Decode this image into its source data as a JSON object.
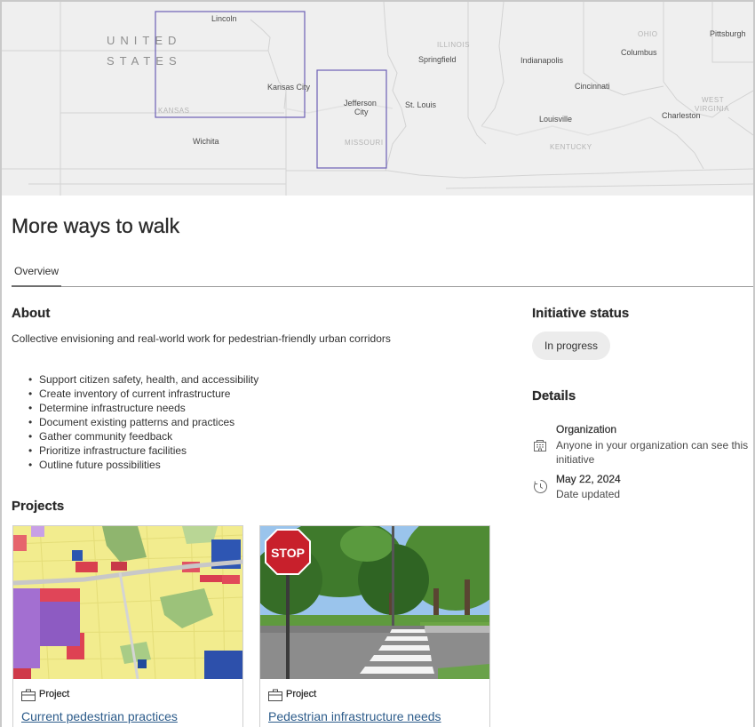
{
  "map": {
    "country_line1": "UNITED",
    "country_line2": "STATES",
    "labels": {
      "lincoln": "Lincoln",
      "kansas_city": "Kansas City",
      "kansas": "KANSAS",
      "wichita": "Wichita",
      "jefferson_city_1": "Jefferson",
      "jefferson_city_2": "City",
      "missouri": "MISSOURI",
      "st_louis": "St. Louis",
      "illinois": "ILLINOIS",
      "springfield": "Springfield",
      "indianapolis": "Indianapolis",
      "ohio": "OHIO",
      "columbus": "Columbus",
      "pittsburgh": "Pittsburgh",
      "cincinnati": "Cincinnati",
      "louisville": "Louisville",
      "kentucky": "KENTUCKY",
      "charleston": "Charleston",
      "west_virginia_1": "WEST",
      "west_virginia_2": "VIRGINIA"
    },
    "highlight_color": "#6b5fb5"
  },
  "page": {
    "title": "More ways to walk"
  },
  "tabs": [
    {
      "label": "Overview",
      "active": true
    }
  ],
  "about": {
    "heading": "About",
    "description": "Collective envisioning and real-world work for pedestrian-friendly urban corridors",
    "bullets": [
      "Support citizen safety, health, and accessibility",
      "Create inventory of current infrastructure",
      "Determine infrastructure needs",
      "Document existing patterns and practices",
      "Gather community feedback",
      "Prioritize infrastructure facilities",
      "Outline future possibilities"
    ]
  },
  "status": {
    "heading": "Initiative status",
    "value": "In progress"
  },
  "details": {
    "heading": "Details",
    "organization_title": "Organization",
    "organization_text_1": "Anyone in your organization can see this",
    "organization_text_2": "initiative",
    "organization_icon": "organization-icon",
    "date_title": "May 22, 2024",
    "date_text": "Date updated",
    "date_icon": "clock-icon"
  },
  "projects": {
    "heading": "Projects",
    "cards": [
      {
        "type": "Project",
        "title": "Current pedestrian practices",
        "thumb": "land-use-map"
      },
      {
        "type": "Project",
        "title": "Pedestrian infrastructure needs",
        "thumb": "stop-sign-crosswalk-photo"
      }
    ]
  },
  "colors": {
    "link": "#2c5b8a",
    "pill_bg": "#ececec",
    "map_bg": "#efefef"
  }
}
